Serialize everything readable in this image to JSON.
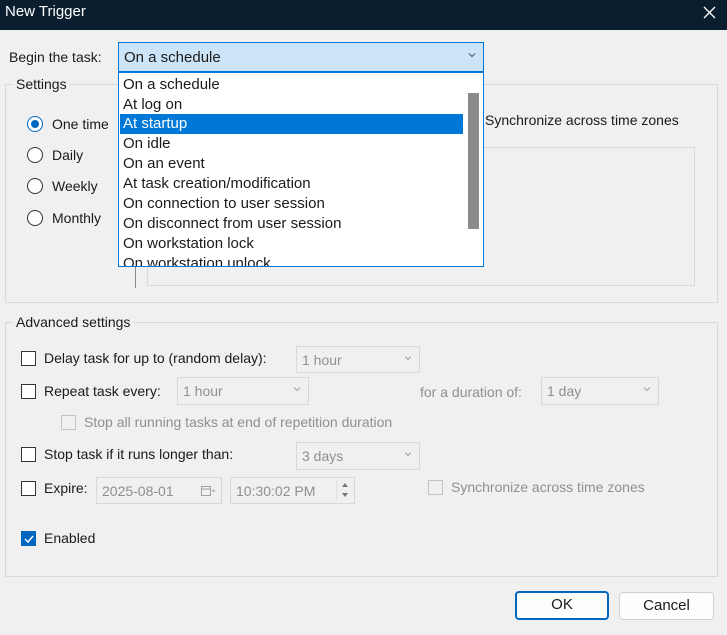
{
  "window": {
    "title": "New Trigger"
  },
  "begin": {
    "label": "Begin the task:",
    "value": "On a schedule",
    "options": [
      "On a schedule",
      "At log on",
      "At startup",
      "On idle",
      "On an event",
      "At task creation/modification",
      "On connection to user session",
      "On disconnect from user session",
      "On workstation lock",
      "On workstation unlock"
    ],
    "highlighted": "At startup"
  },
  "settings": {
    "title": "Settings",
    "radios": [
      "One time",
      "Daily",
      "Weekly",
      "Monthly"
    ],
    "selected": "One time",
    "sync_label": "Synchronize across time zones"
  },
  "advanced": {
    "title": "Advanced settings",
    "delay": {
      "label": "Delay task for up to (random delay):",
      "value": "1 hour",
      "checked": false
    },
    "repeat": {
      "label": "Repeat task every:",
      "value": "1 hour",
      "duration_label": "for a duration of:",
      "duration_value": "1 day",
      "checked": false
    },
    "stop_running": {
      "label": "Stop all running tasks at end of repetition duration",
      "checked": false
    },
    "stop_longer": {
      "label": "Stop task if it runs longer than:",
      "value": "3 days",
      "checked": false
    },
    "expire": {
      "label": "Expire:",
      "date": "2025-08-01",
      "time": "10:30:02 PM",
      "checked": false
    },
    "expire_sync": {
      "label": "Synchronize across time zones",
      "checked": false
    },
    "enabled": {
      "label": "Enabled",
      "checked": true
    }
  },
  "buttons": {
    "ok": "OK",
    "cancel": "Cancel"
  },
  "colors": {
    "accent": "#0078d7",
    "titlebar": "#0b1e30",
    "checkbox_checked": "#0067c0"
  }
}
